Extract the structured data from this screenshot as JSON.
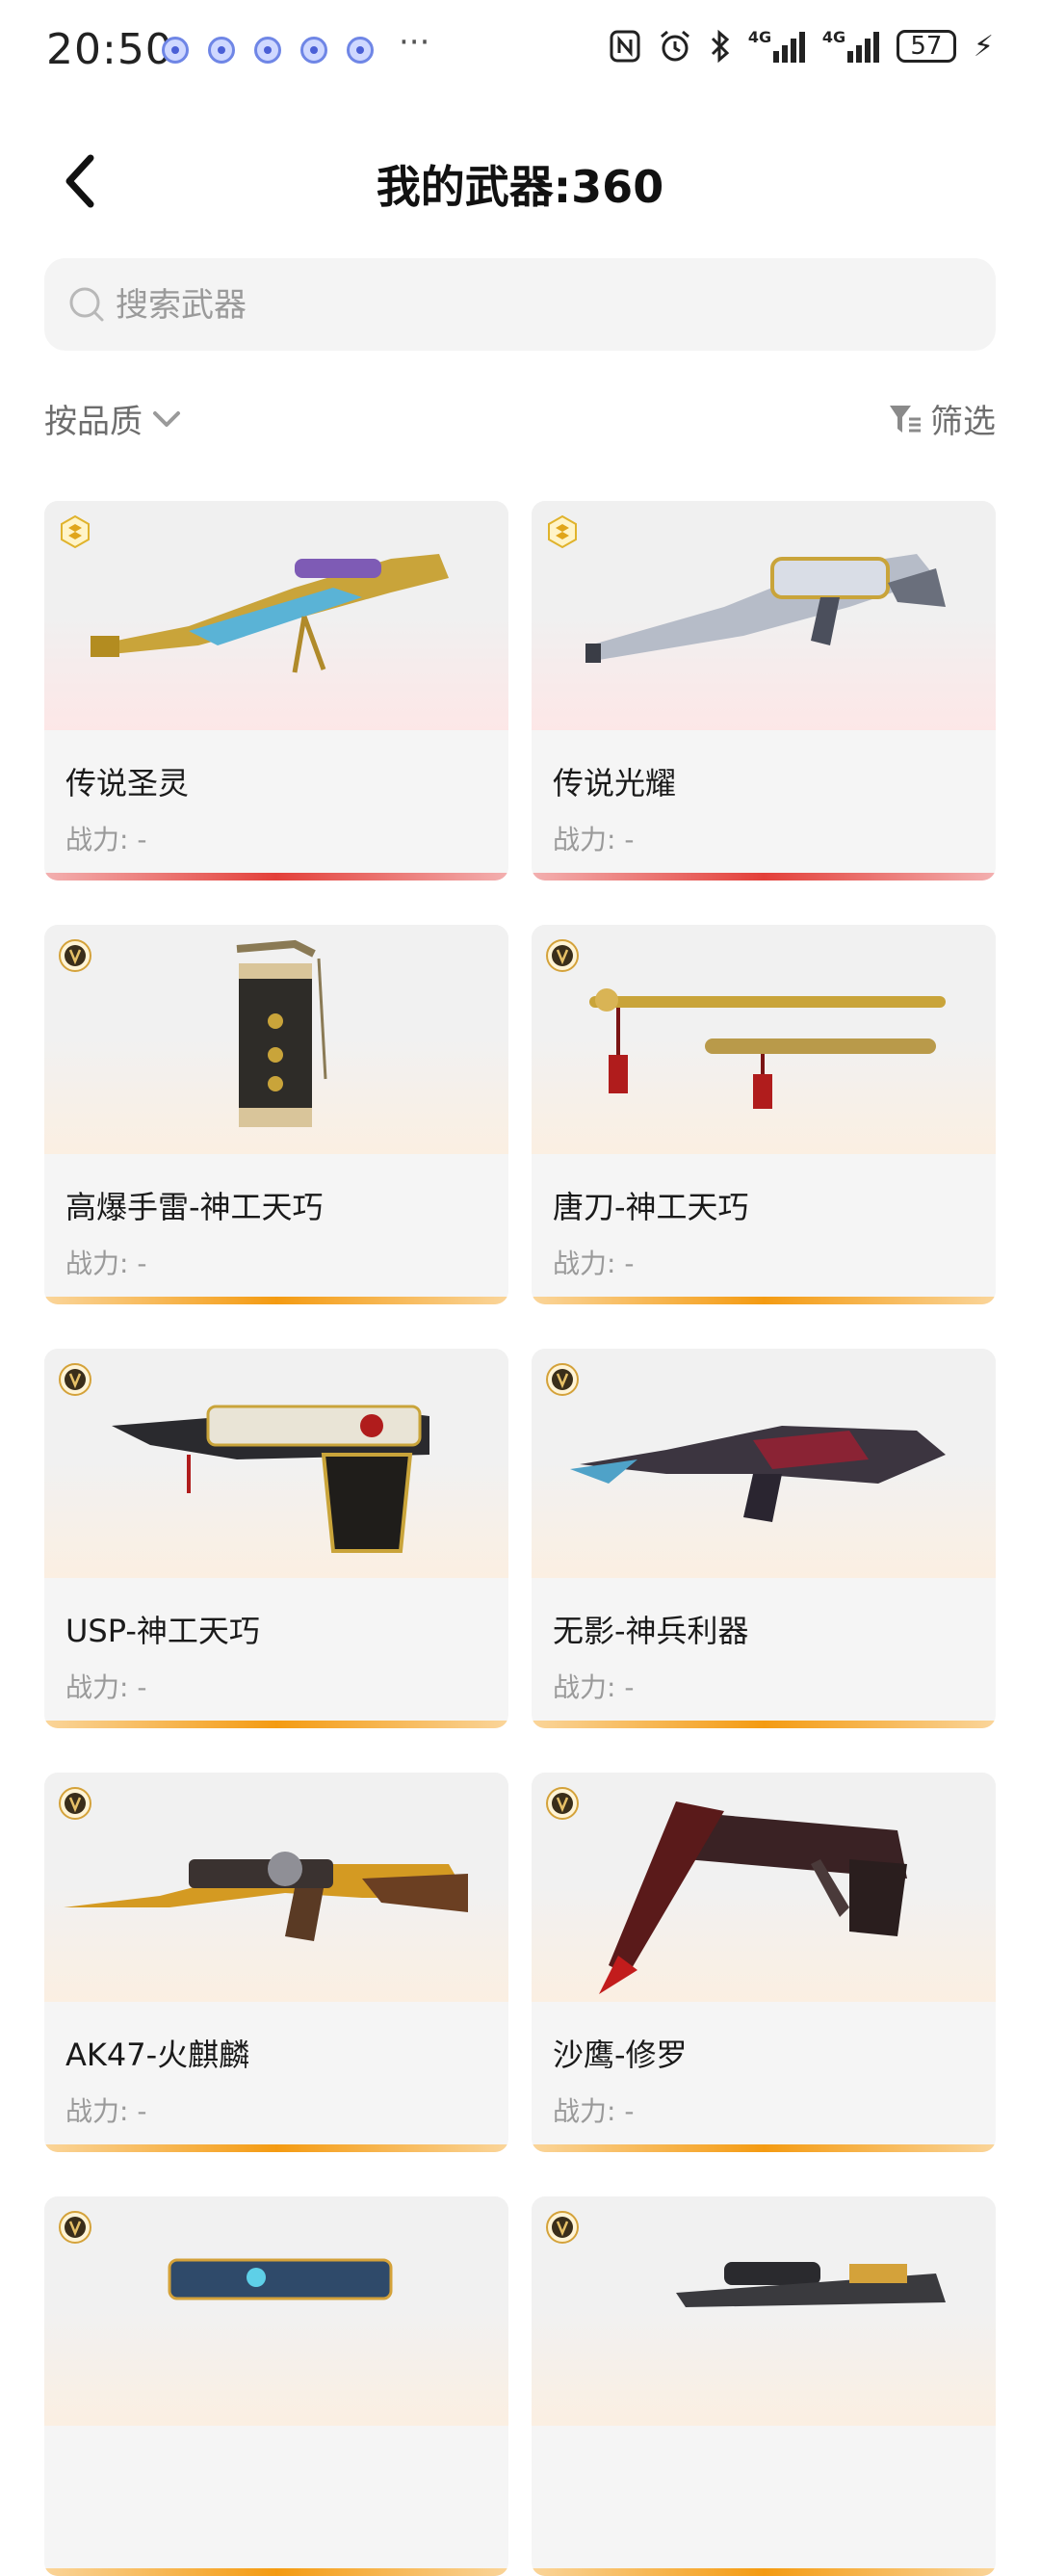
{
  "status_bar": {
    "time": "20:50",
    "more": "···",
    "battery": "57",
    "network_1": "4G",
    "network_2": "4G"
  },
  "header": {
    "title": "我的武器:360"
  },
  "search": {
    "placeholder": "搜索武器"
  },
  "sort": {
    "label": "按品质"
  },
  "filter": {
    "label": "筛选"
  },
  "weapons": [
    {
      "name": "传说圣灵",
      "power": "战力: -",
      "quality": "legend"
    },
    {
      "name": "传说光耀",
      "power": "战力: -",
      "quality": "legend"
    },
    {
      "name": "高爆手雷-神工天巧",
      "power": "战力: -",
      "quality": "epic"
    },
    {
      "name": "唐刀-神工天巧",
      "power": "战力: -",
      "quality": "epic"
    },
    {
      "name": "USP-神工天巧",
      "power": "战力: -",
      "quality": "epic"
    },
    {
      "name": "无影-神兵利器",
      "power": "战力: -",
      "quality": "epic"
    },
    {
      "name": "AK47-火麒麟",
      "power": "战力: -",
      "quality": "epic"
    },
    {
      "name": "沙鹰-修罗",
      "power": "战力: -",
      "quality": "epic"
    },
    {
      "name": "",
      "power": "",
      "quality": "epic"
    },
    {
      "name": "",
      "power": "",
      "quality": "epic"
    }
  ],
  "colors": {
    "legend_accent": "#e3403a",
    "epic_accent": "#f49b12",
    "card_bg": "#f5f5f5",
    "search_bg": "#f4f4f4"
  }
}
